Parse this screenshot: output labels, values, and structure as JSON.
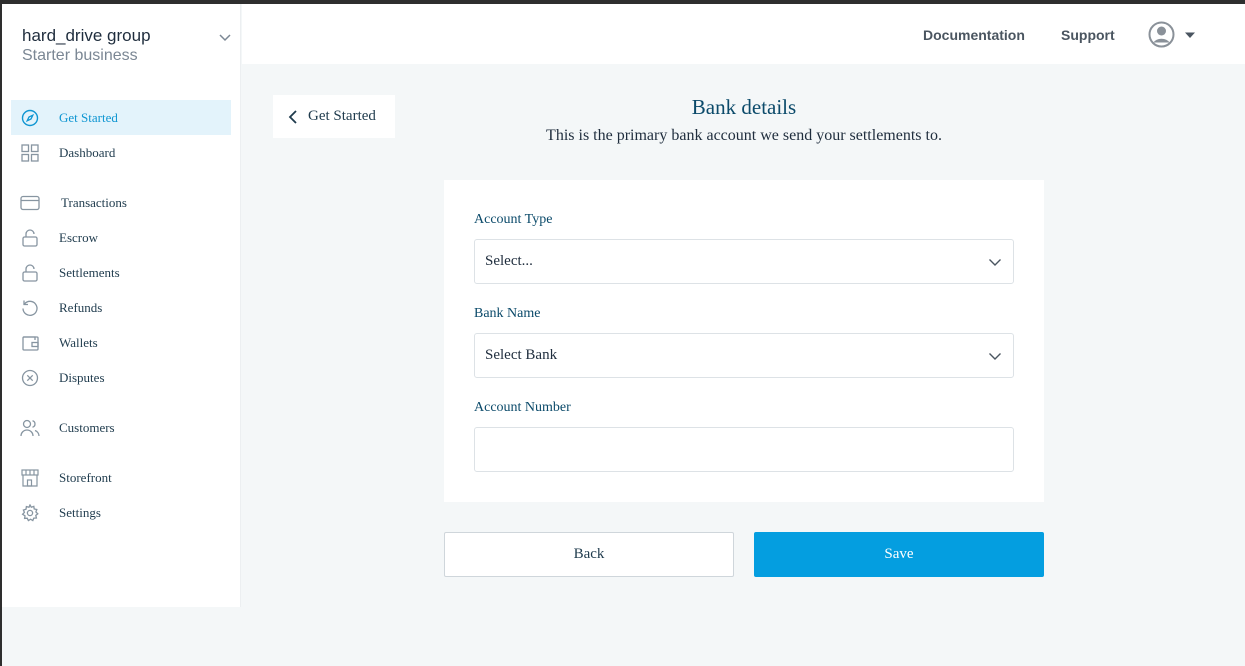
{
  "org": {
    "name": "hard_drive group",
    "plan": "Starter business"
  },
  "sidebar": {
    "items": [
      {
        "label": "Get Started",
        "icon": "compass-icon",
        "active": true
      },
      {
        "label": "Dashboard",
        "icon": "grid-icon"
      },
      {
        "label": "Transactions",
        "icon": "credit-card-icon"
      },
      {
        "label": "Escrow",
        "icon": "unlock-icon"
      },
      {
        "label": "Settlements",
        "icon": "unlock-icon"
      },
      {
        "label": "Refunds",
        "icon": "refresh-icon"
      },
      {
        "label": "Wallets",
        "icon": "wallet-icon"
      },
      {
        "label": "Disputes",
        "icon": "x-circle-icon"
      },
      {
        "label": "Customers",
        "icon": "users-icon"
      },
      {
        "label": "Storefront",
        "icon": "storefront-icon"
      },
      {
        "label": "Settings",
        "icon": "gear-icon"
      }
    ]
  },
  "header": {
    "documentation": "Documentation",
    "support": "Support",
    "avatar_icon": "user-circle-icon"
  },
  "back_pill": {
    "label": "Get Started"
  },
  "page": {
    "title": "Bank details",
    "subtitle": "This is the primary bank account we send your settlements to."
  },
  "form": {
    "account_type": {
      "label": "Account Type",
      "value": "Select..."
    },
    "bank_name": {
      "label": "Bank Name",
      "value": "Select Bank"
    },
    "account_number": {
      "label": "Account Number",
      "value": ""
    }
  },
  "buttons": {
    "back": "Back",
    "save": "Save"
  },
  "colors": {
    "accent": "#049ee0",
    "active_bg": "#e3f3fb",
    "heading": "#0b4a6a"
  }
}
